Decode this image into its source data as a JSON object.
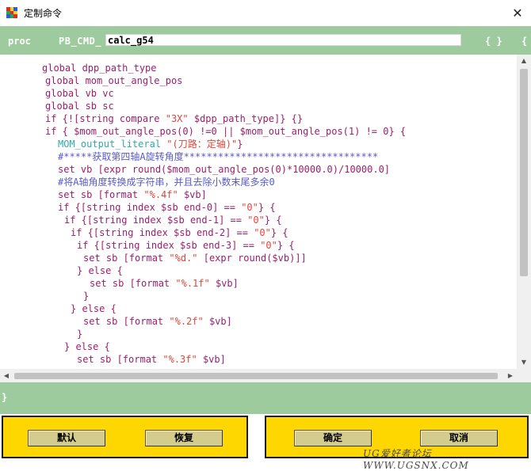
{
  "window": {
    "title": "定制命令",
    "close_glyph": "✕"
  },
  "colors": {
    "green_bar": "#9ecb9e",
    "button_panel": "#ffd700",
    "keyword": "#9b1f6a",
    "string": "#e0443a",
    "variable": "#1a1a7a",
    "comment": "#5a5acc",
    "literal": "#31a8a8",
    "plain": "#000000"
  },
  "proc_bar": {
    "keyword": "proc",
    "prefix": "PB_CMD_",
    "name": "calc_g54",
    "brace_open": "{ }",
    "brace_extra": "{"
  },
  "code_lines": [
    {
      "indent": 0,
      "segments": [
        {
          "t": "global dpp_path_type",
          "c": "kw"
        }
      ]
    },
    {
      "indent": 1,
      "segments": [
        {
          "t": "global mom_out_angle_pos",
          "c": "kw"
        }
      ]
    },
    {
      "indent": 1,
      "segments": [
        {
          "t": "global vb vc",
          "c": "kw"
        }
      ]
    },
    {
      "indent": 1,
      "segments": [
        {
          "t": "global sb sc",
          "c": "kw"
        }
      ]
    },
    {
      "indent": 1,
      "segments": [
        {
          "t": "if {![string compare ",
          "c": "kw"
        },
        {
          "t": "\"3X\"",
          "c": "str"
        },
        {
          "t": " $dpp_path_type]} {}",
          "c": "kw"
        }
      ]
    },
    {
      "indent": 1,
      "segments": [
        {
          "t": "if { $mom_out_angle_pos(0) !=0 || $mom_out_angle_pos(1) != 0} {",
          "c": "kw"
        }
      ]
    },
    {
      "indent": 5,
      "segments": [
        {
          "t": "MOM_output_literal ",
          "c": "lit"
        },
        {
          "t": "\"(刀路：定轴)\"",
          "c": "str"
        },
        {
          "t": "}",
          "c": "kw"
        }
      ]
    },
    {
      "indent": 5,
      "segments": [
        {
          "t": "#*****获取第四轴A旋转角度**********************************",
          "c": "cmt"
        }
      ]
    },
    {
      "indent": 5,
      "segments": [
        {
          "t": "set vb [expr round($mom_out_angle_pos(0)*10000.0)/10000.0]",
          "c": "kw"
        }
      ]
    },
    {
      "indent": 5,
      "segments": [
        {
          "t": "#将A轴角度转换成字符串，并且去除小数末尾多余0",
          "c": "cmt"
        }
      ]
    },
    {
      "indent": 5,
      "segments": [
        {
          "t": "set sb [format ",
          "c": "kw"
        },
        {
          "t": "\"%.4f\"",
          "c": "str"
        },
        {
          "t": " $vb]",
          "c": "kw"
        }
      ]
    },
    {
      "indent": 5,
      "segments": [
        {
          "t": "if {[string index $sb end-0] == ",
          "c": "kw"
        },
        {
          "t": "\"0\"",
          "c": "str"
        },
        {
          "t": "} {",
          "c": "kw"
        }
      ]
    },
    {
      "indent": 7,
      "segments": [
        {
          "t": "if {[string index $sb end-1] == ",
          "c": "kw"
        },
        {
          "t": "\"0\"",
          "c": "str"
        },
        {
          "t": "} {",
          "c": "kw"
        }
      ]
    },
    {
      "indent": 9,
      "segments": [
        {
          "t": "if {[string index $sb end-2] == ",
          "c": "kw"
        },
        {
          "t": "\"0\"",
          "c": "str"
        },
        {
          "t": "} {",
          "c": "kw"
        }
      ]
    },
    {
      "indent": 11,
      "segments": [
        {
          "t": "if {[string index $sb end-3] == ",
          "c": "kw"
        },
        {
          "t": "\"0\"",
          "c": "str"
        },
        {
          "t": "} {",
          "c": "kw"
        }
      ]
    },
    {
      "indent": 13,
      "segments": [
        {
          "t": "set sb [format ",
          "c": "kw"
        },
        {
          "t": "\"%d.\"",
          "c": "str"
        },
        {
          "t": " [expr round($vb)]]",
          "c": "kw"
        }
      ]
    },
    {
      "indent": 11,
      "segments": [
        {
          "t": "} else {",
          "c": "kw"
        }
      ]
    },
    {
      "indent": 15,
      "segments": [
        {
          "t": "set sb [format ",
          "c": "kw"
        },
        {
          "t": "\"%.1f\"",
          "c": "str"
        },
        {
          "t": " $vb]",
          "c": "kw"
        }
      ]
    },
    {
      "indent": 13,
      "segments": [
        {
          "t": "}",
          "c": "kw"
        }
      ]
    },
    {
      "indent": 9,
      "segments": [
        {
          "t": "} else {",
          "c": "kw"
        }
      ]
    },
    {
      "indent": 13,
      "segments": [
        {
          "t": "set sb [format ",
          "c": "kw"
        },
        {
          "t": "\"%.2f\"",
          "c": "str"
        },
        {
          "t": " $vb]",
          "c": "kw"
        }
      ]
    },
    {
      "indent": 11,
      "segments": [
        {
          "t": "}",
          "c": "kw"
        }
      ]
    },
    {
      "indent": 7,
      "segments": [
        {
          "t": "} else {",
          "c": "kw"
        }
      ]
    },
    {
      "indent": 11,
      "segments": [
        {
          "t": "set sb [format ",
          "c": "kw"
        },
        {
          "t": "\"%.3f\"",
          "c": "str"
        },
        {
          "t": " $vb]",
          "c": "kw"
        }
      ]
    }
  ],
  "end_bar": {
    "brace_close": "}"
  },
  "buttons": {
    "default_label": "默认",
    "restore_label": "恢复",
    "ok_label": "确定",
    "cancel_label": "取消"
  },
  "watermark": "UG爱好者论坛 WWW.UGSNX.COM"
}
